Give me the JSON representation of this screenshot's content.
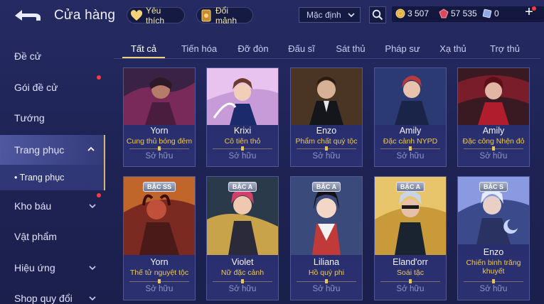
{
  "header": {
    "title": "Cửa hàng",
    "wishlist_label": "Yêu thích",
    "exchange_label": "Đổi mảnh",
    "sort_selected": "Mặc định"
  },
  "currency": {
    "gold": "3 507",
    "coupons": "57 535",
    "vouchers": "0"
  },
  "sidebar": {
    "items": [
      {
        "label": "Đề cử"
      },
      {
        "label": "Gói đề cử"
      },
      {
        "label": "Tướng"
      },
      {
        "label": "Trang phục"
      },
      {
        "label": "Kho báu"
      },
      {
        "label": "Vật phẩm"
      },
      {
        "label": "Hiệu ứng"
      },
      {
        "label": "Shop quy đổi"
      }
    ],
    "sub_item": "Trang phục"
  },
  "tabs": [
    "Tất cả",
    "Tiến hóa",
    "Đỡ đòn",
    "Đấu sĩ",
    "Sát thủ",
    "Pháp sư",
    "Xạ thủ",
    "Trợ thủ"
  ],
  "cards_row1": [
    {
      "hero": "Yorn",
      "skin": "Cung thủ bóng đêm",
      "status": "Sở hữu"
    },
    {
      "hero": "Krixi",
      "skin": "Cô tiên thỏ",
      "status": "Sở hữu"
    },
    {
      "hero": "Enzo",
      "skin": "Phẩm chất quý tộc",
      "status": "Sở hữu"
    },
    {
      "hero": "Amily",
      "skin": "Đặc cảnh NYPD",
      "status": "Sở hữu"
    },
    {
      "hero": "Amily",
      "skin": "Đặc công Nhện đỏ",
      "status": "Sở hữu"
    }
  ],
  "cards_row2": [
    {
      "hero": "Yorn",
      "skin": "Thế tử nguyệt tộc",
      "status": "Sở hữu",
      "badge": "BẬC SS"
    },
    {
      "hero": "Violet",
      "skin": "Nữ đặc cảnh",
      "status": "Sở hữu",
      "badge": "BẬC A"
    },
    {
      "hero": "Liliana",
      "skin": "Hồ quý phi",
      "status": "Sở hữu",
      "badge": "BẬC A"
    },
    {
      "hero": "Eland'orr",
      "skin": "Soái tặc",
      "status": "Sở hữu",
      "badge": "BẬC A"
    },
    {
      "hero": "Enzo",
      "skin": "Chiến binh trăng khuyết",
      "status": "Sở hữu",
      "badge": "BẬC S"
    }
  ],
  "colors": {
    "background": "#1f2456",
    "accent_gold": "#f0c94a",
    "tab_underline": "#f0d27a",
    "notification": "#ff3b3b"
  },
  "icons": [
    "back-arrow-icon",
    "heart-icon",
    "card-icon",
    "chevron-down-icon",
    "search-icon",
    "gold-coin-icon",
    "coupon-gem-icon",
    "voucher-icon",
    "plus-icon",
    "chevron-up-icon"
  ]
}
